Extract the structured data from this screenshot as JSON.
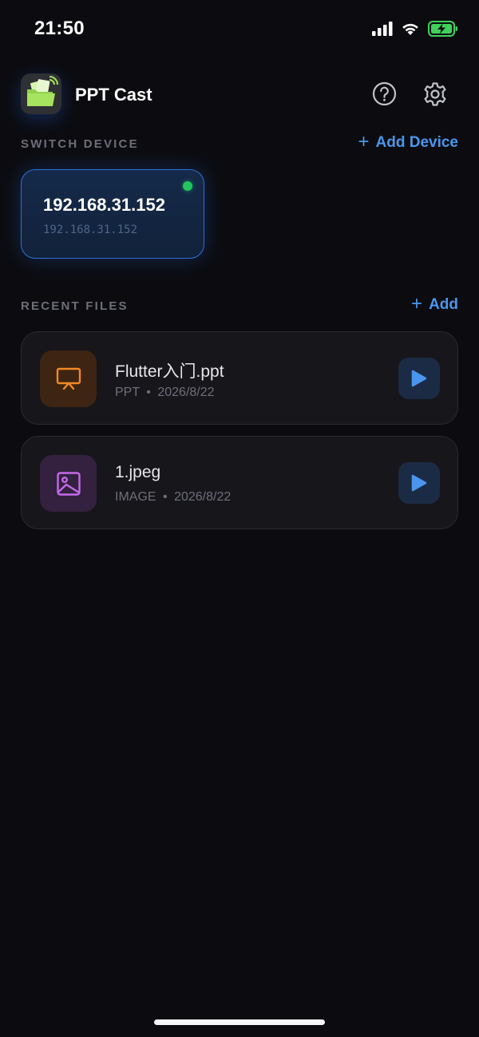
{
  "status_bar": {
    "time": "21:50",
    "icons": [
      "signal-icon",
      "wifi-icon",
      "battery-charging-icon"
    ]
  },
  "header": {
    "app_title": "PPT Cast",
    "icons": [
      "help-icon",
      "settings-gear-icon"
    ]
  },
  "devices_section": {
    "label": "SWITCH DEVICE",
    "action_plus": "+",
    "action_label": "Add Device",
    "devices": [
      {
        "name": "192.168.31.152",
        "ip": "192.168.31.152",
        "online": true
      }
    ]
  },
  "recent_section": {
    "label": "RECENT FILES",
    "action_plus": "+",
    "action_label": "Add",
    "files": [
      {
        "name": "Flutter入门.ppt",
        "type": "PPT",
        "separator": "•",
        "date": "2026/8/22",
        "icon": "presentation-icon"
      },
      {
        "name": "1.jpeg",
        "type": "IMAGE",
        "separator": "•",
        "date": "2026/8/22",
        "icon": "image-icon"
      }
    ]
  },
  "colors": {
    "background": "#0c0c10",
    "accent": "#4a96ee",
    "online": "#22c55e",
    "ppt_icon": "#f08a24",
    "image_icon": "#c46ae8",
    "play_icon": "#4a96ee"
  }
}
